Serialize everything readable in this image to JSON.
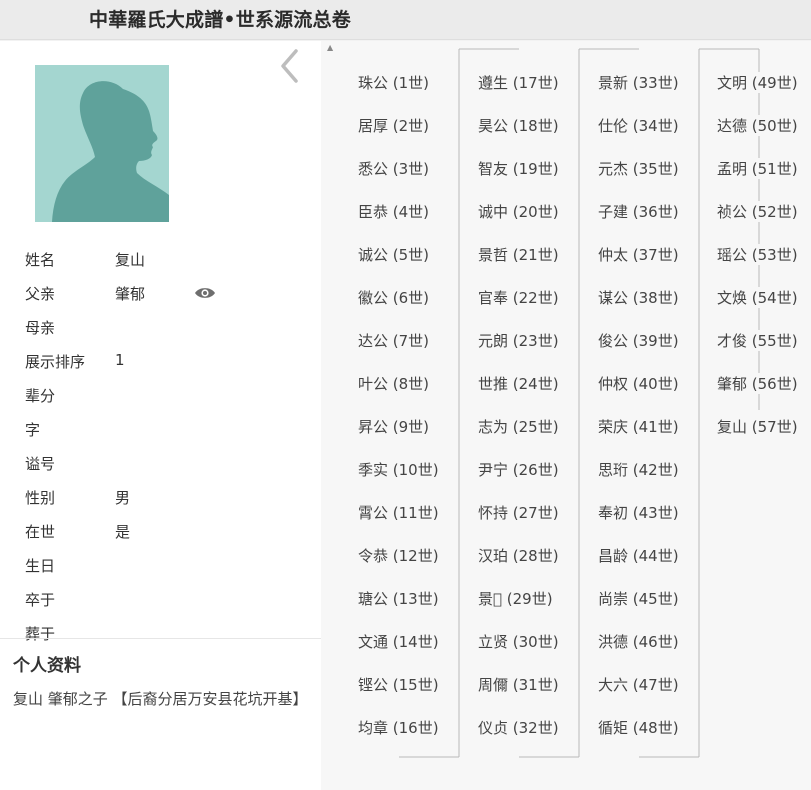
{
  "header": {
    "title": "中華羅氏大成譜•世系源流总卷"
  },
  "person": {
    "fields": [
      {
        "label": "姓名",
        "value": "复山"
      },
      {
        "label": "父亲",
        "value": "肇郁",
        "eye": true
      },
      {
        "label": "母亲",
        "value": ""
      },
      {
        "label": "展示排序",
        "value": "1"
      },
      {
        "label": "辈分",
        "value": ""
      },
      {
        "label": "字",
        "value": ""
      },
      {
        "label": "谥号",
        "value": ""
      },
      {
        "label": "性别",
        "value": "男"
      },
      {
        "label": "在世",
        "value": "是"
      },
      {
        "label": "生日",
        "value": ""
      },
      {
        "label": "卒于",
        "value": ""
      },
      {
        "label": "葬于",
        "value": ""
      }
    ]
  },
  "profile": {
    "title": "个人资料",
    "text": "复山 肇郁之子 【后裔分居万安县花坑开基】"
  },
  "generations": [
    "珠公 (1世)",
    "居厚 (2世)",
    "悉公 (3世)",
    "臣恭 (4世)",
    "诚公 (5世)",
    "徽公 (6世)",
    "达公 (7世)",
    "叶公 (8世)",
    "昇公 (9世)",
    "季实 (10世)",
    "霄公 (11世)",
    "令恭 (12世)",
    "瑭公 (13世)",
    "文通 (14世)",
    "铿公 (15世)",
    "均章 (16世)",
    "遵生 (17世)",
    "昊公 (18世)",
    "智友 (19世)",
    "诚中 (20世)",
    "景哲 (21世)",
    "官奉 (22世)",
    "元朗 (23世)",
    "世推 (24世)",
    "志为 (25世)",
    "尹宁 (26世)",
    "怀持 (27世)",
    "汉珀 (28世)",
    "景𪷋 (29世)",
    "立贤 (30世)",
    "周儞 (31世)",
    "仪贞 (32世)",
    "景新 (33世)",
    "仕伦 (34世)",
    "元杰 (35世)",
    "子建 (36世)",
    "仲太 (37世)",
    "谋公 (38世)",
    "俊公 (39世)",
    "仲权 (40世)",
    "荣庆 (41世)",
    "思珩 (42世)",
    "奉初 (43世)",
    "昌龄 (44世)",
    "尚崇 (45世)",
    "洪德 (46世)",
    "大六 (47世)",
    "循矩 (48世)",
    "文明 (49世)",
    "达德 (50世)",
    "孟明 (51世)",
    "祯公 (52世)",
    "瑶公 (53世)",
    "文焕 (54世)",
    "才俊 (55世)",
    "肇郁 (56世)",
    "复山 (57世)"
  ]
}
